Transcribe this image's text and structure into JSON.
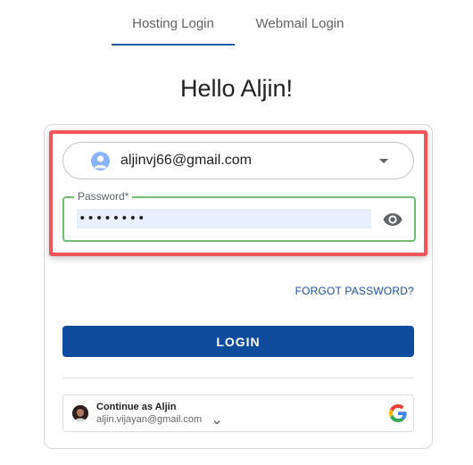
{
  "tabs": [
    {
      "label": "Hosting Login",
      "active": true
    },
    {
      "label": "Webmail Login",
      "active": false
    }
  ],
  "greeting": "Hello Aljin!",
  "account": {
    "email": "aljinvj66@gmail.com",
    "avatar_icon": "person-icon",
    "dropdown_icon": "caret-down-icon"
  },
  "password": {
    "label": "Password*",
    "value": "••••••••",
    "toggle_icon": "eye-icon"
  },
  "forgot_password": "FORGOT PASSWORD?",
  "login_button": "LOGIN",
  "google": {
    "name": "Continue as Aljin",
    "email": "aljin.vijayan@gmail.com",
    "icon": "google-g-icon"
  },
  "colors": {
    "primary": "#0f4c9e",
    "link": "#1a4f9c",
    "field_valid_border": "#6fbf73",
    "highlight": "#f0555a"
  }
}
